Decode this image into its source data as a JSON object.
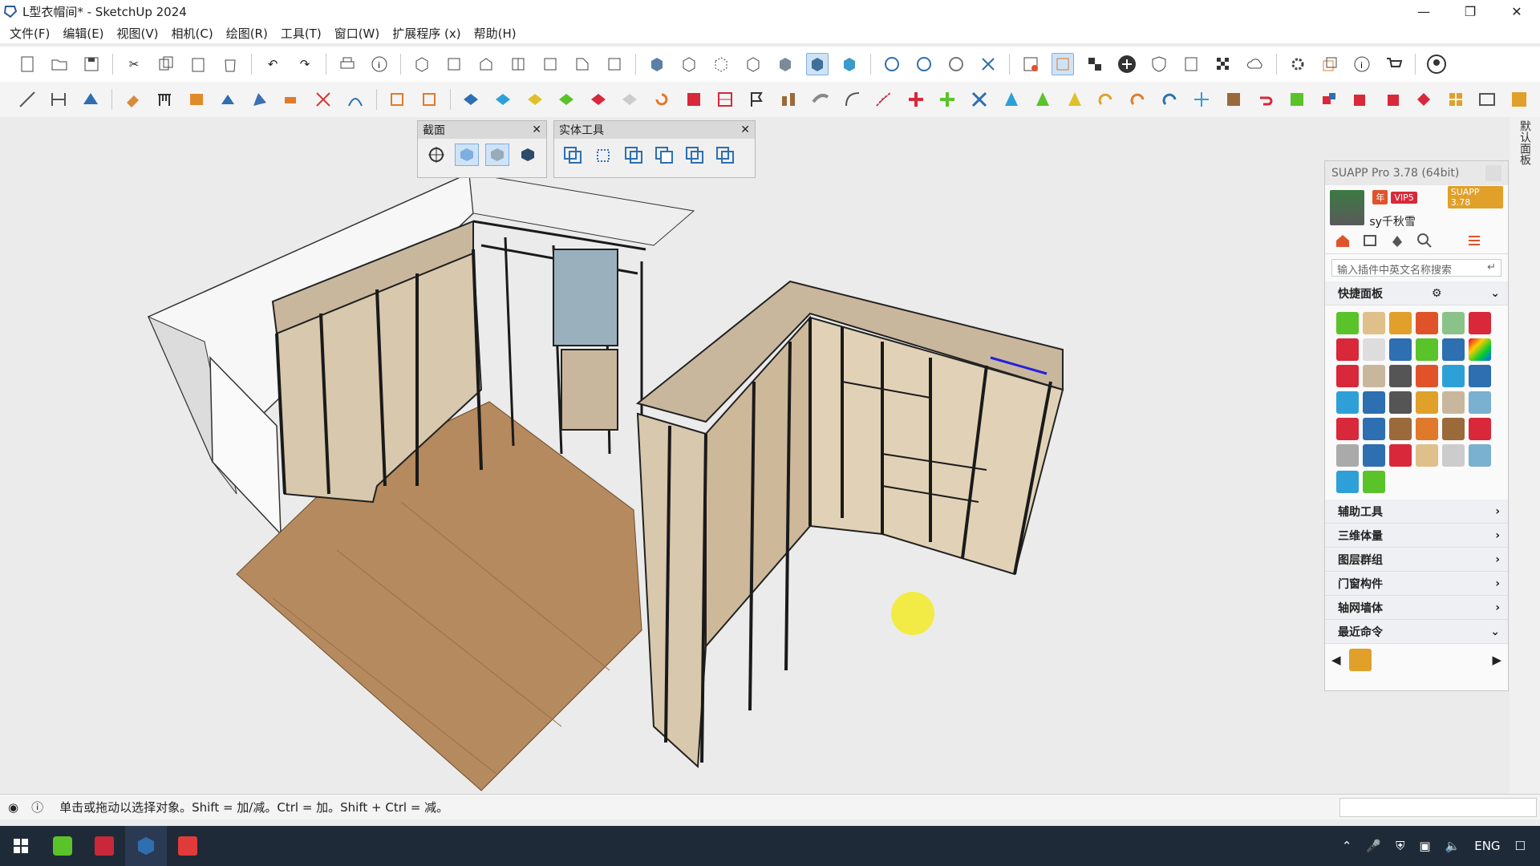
{
  "window": {
    "title": "L型衣帽间* - SketchUp 2024"
  },
  "menu": [
    "文件(F)",
    "编辑(E)",
    "视图(V)",
    "相机(C)",
    "绘图(R)",
    "工具(T)",
    "窗口(W)",
    "扩展程序 (x)",
    "帮助(H)"
  ],
  "section_panel": {
    "title": "截面"
  },
  "solid_tools_panel": {
    "title": "实体工具"
  },
  "right_strip": {
    "label": "默认面板"
  },
  "suapp": {
    "title": "SUAPP Pro 3.78 (64bit)",
    "username": "sy千秋雪",
    "badge_year": "年",
    "badge_vip": "VIP5",
    "version_badge": "SUAPP 3.78",
    "search_placeholder": "输入插件中英文名称搜索",
    "quick_panel": "快捷面板",
    "sections": [
      "辅助工具",
      "三维体量",
      "图层群组",
      "门窗构件",
      "轴网墙体",
      "最近命令"
    ]
  },
  "status": {
    "hint": "单击或拖动以选择对象。Shift = 加/减。Ctrl = 加。Shift + Ctrl = 减。"
  },
  "taskbar": {
    "lang": "ENG"
  },
  "colors": {
    "accent": "#e0532a",
    "wood": "#c9b79d",
    "floor": "#b58a5e"
  }
}
